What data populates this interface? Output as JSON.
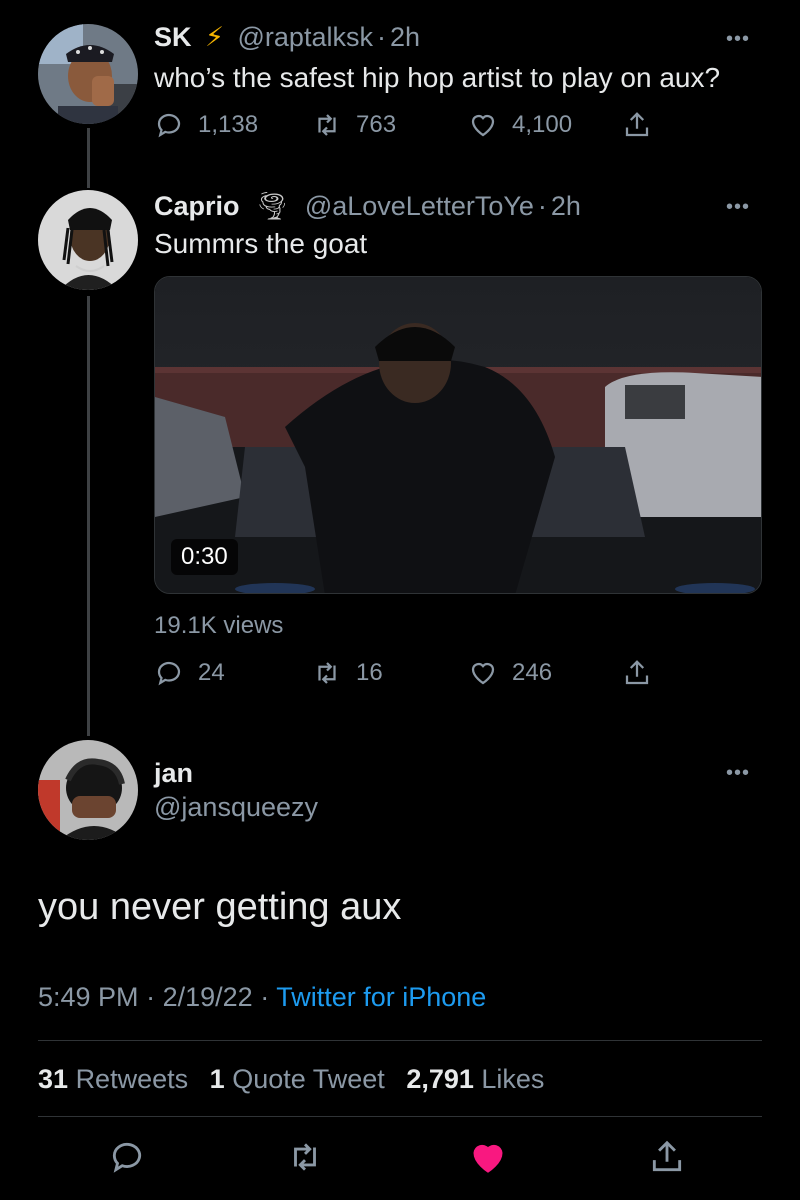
{
  "tweet1": {
    "name": "SK",
    "handle": "@raptalksk",
    "time": "2h",
    "text": "who’s the safest hip hop artist to play on aux?",
    "replies": "1,138",
    "retweets": "763",
    "likes": "4,100"
  },
  "tweet2": {
    "name": "Caprio",
    "handle": "@aLoveLetterToYe",
    "time": "2h",
    "text": "Summrs the goat",
    "video_duration": "0:30",
    "views": "19.1K views",
    "replies": "24",
    "retweets": "16",
    "likes": "246"
  },
  "main": {
    "name": "jan",
    "handle": "@jansqueezy",
    "text": "you never getting aux",
    "time": "5:49 PM",
    "date": "2/19/22",
    "source": "Twitter for iPhone",
    "retweets_count": "31",
    "retweets_label": "Retweets",
    "quotes_count": "1",
    "quotes_label": "Quote Tweet",
    "likes_count": "2,791",
    "likes_label": "Likes"
  },
  "colors": {
    "background": "#000000",
    "text": "#e7e9ea",
    "muted": "#8b98a5",
    "link": "#1d9bf0",
    "like_active": "#f91880",
    "bolt": "#f5b400"
  }
}
